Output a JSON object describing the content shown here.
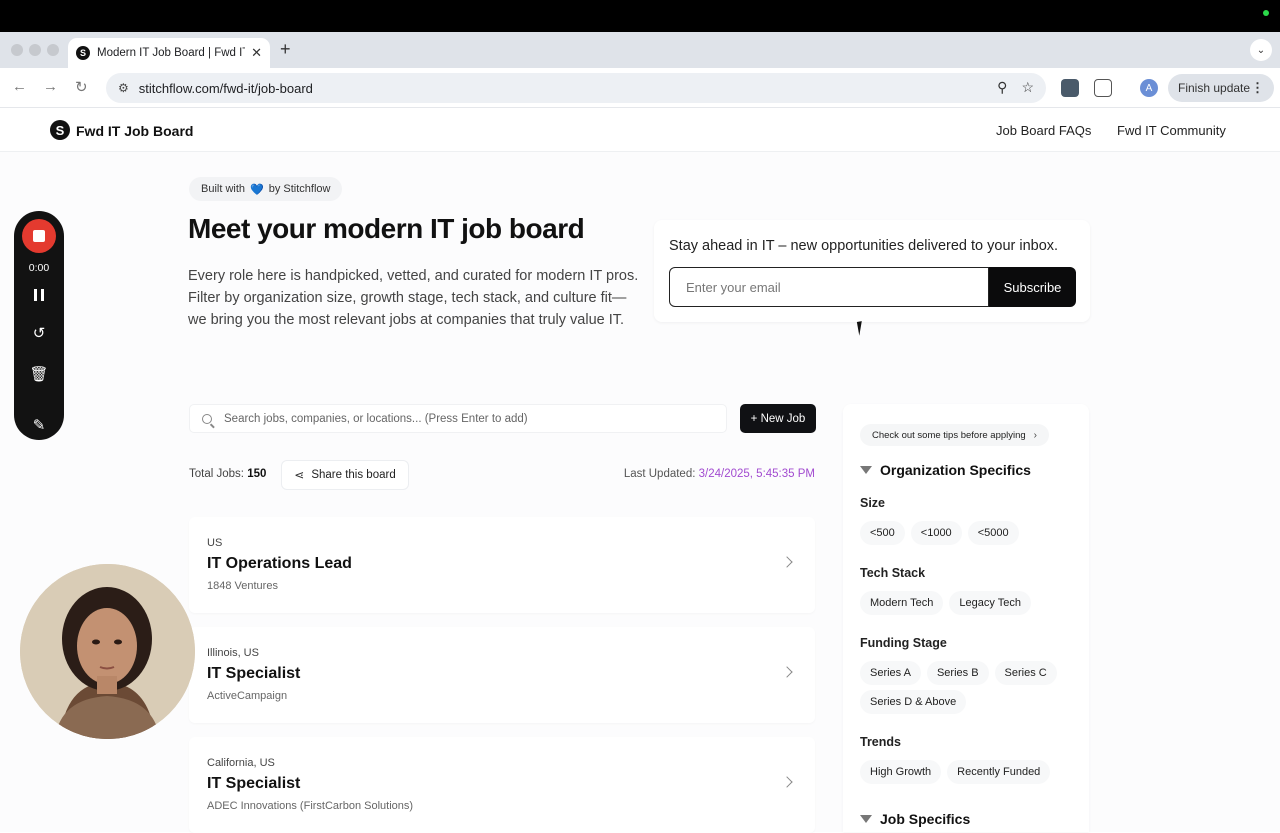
{
  "browser": {
    "tab_title": "Modern IT Job Board | Fwd IT",
    "tab_favicon": "S",
    "tab_close": "✕",
    "new_tab": "+",
    "url": "stitchflow.com/fwd-it/job-board",
    "finish_update_label": "Finish update",
    "profile_initial": "A"
  },
  "site": {
    "logo_glyph": "S",
    "brand": "Fwd IT Job Board",
    "nav": [
      "Job Board FAQs",
      "Fwd IT Community"
    ]
  },
  "hero": {
    "built_with_prefix": "Built with",
    "built_with_heart": "💙",
    "built_with_suffix": "by Stitchflow",
    "title": "Meet your modern IT job board",
    "description": "Every role here is handpicked, vetted, and curated for modern IT pros. Filter by organization size, growth stage, tech stack, and culture fit—we bring you the most relevant jobs at companies that truly value IT."
  },
  "subscribe": {
    "heading": "Stay ahead in IT – new opportunities delivered to your inbox.",
    "email_placeholder": "Enter your email",
    "button_label": "Subscribe"
  },
  "search": {
    "placeholder": "Search jobs, companies, or locations... (Press Enter to add)",
    "new_job_label": "+ New Job"
  },
  "stats": {
    "total_label": "Total Jobs:",
    "total_value": "150",
    "share_label": "Share this board",
    "last_updated_label": "Last Updated:",
    "last_updated_value": "3/24/2025, 5:45:35 PM",
    "accent_color": "#a24bd0"
  },
  "jobs": [
    {
      "location": "US",
      "title": "IT Operations Lead",
      "company": "1848 Ventures"
    },
    {
      "location": "Illinois, US",
      "title": "IT Specialist",
      "company": "ActiveCampaign"
    },
    {
      "location": "California, US",
      "title": "IT Specialist",
      "company": "ADEC Innovations (FirstCarbon Solutions)"
    }
  ],
  "filters": {
    "tips_label": "Check out some tips before applying",
    "org_heading": "Organization Specifics",
    "size_label": "Size",
    "size_options": [
      "<500",
      "<1000",
      "<5000"
    ],
    "tech_label": "Tech Stack",
    "tech_options": [
      "Modern Tech",
      "Legacy Tech"
    ],
    "funding_label": "Funding Stage",
    "funding_options": [
      "Series A",
      "Series B",
      "Series C",
      "Series D & Above"
    ],
    "trends_label": "Trends",
    "trends_options": [
      "High Growth",
      "Recently Funded"
    ],
    "job_heading": "Job Specifics"
  },
  "recorder": {
    "time": "0:00",
    "stop_color": "#e43a2f",
    "icons": [
      "stop-icon",
      "pause-icon",
      "restart-icon",
      "trash-icon",
      "pencil-icon"
    ]
  }
}
